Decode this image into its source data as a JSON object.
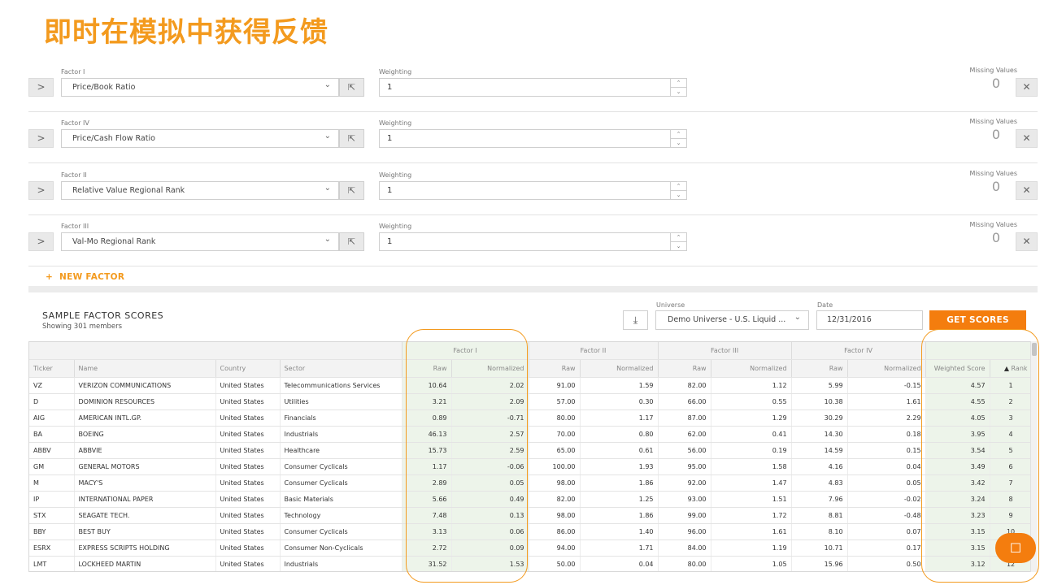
{
  "slide_title": "即时在模拟中获得反馈",
  "factors": [
    {
      "label": "Factor I",
      "value": "Price/Book Ratio",
      "weight_label": "Weighting",
      "weight": "1",
      "missing_label": "Missing Values",
      "missing": "0"
    },
    {
      "label": "Factor IV",
      "value": "Price/Cash Flow Ratio",
      "weight_label": "Weighting",
      "weight": "1",
      "missing_label": "Missing Values",
      "missing": "0"
    },
    {
      "label": "Factor II",
      "value": "Relative Value Regional Rank",
      "weight_label": "Weighting",
      "weight": "1",
      "missing_label": "Missing Values",
      "missing": "0"
    },
    {
      "label": "Factor III",
      "value": "Val-Mo Regional Rank",
      "weight_label": "Weighting",
      "weight": "1",
      "missing_label": "Missing Values",
      "missing": "0"
    }
  ],
  "icons": {
    "expand": ">",
    "chevron": "⌄",
    "cursor": "⇱",
    "remove": "✕",
    "up": "⌃",
    "down": "⌄",
    "download": "⤓",
    "plus": "+",
    "sort": "▲",
    "chat": "☐"
  },
  "new_factor_label": "NEW FACTOR",
  "scores": {
    "title": "SAMPLE FACTOR SCORES",
    "subtitle": "Showing 301 members",
    "universe_label": "Universe",
    "universe_value": "Demo Universe - U.S. Liquid ...",
    "date_label": "Date",
    "date_value": "12/31/2016",
    "get_scores_label": "GET SCORES"
  },
  "table": {
    "groups": [
      "Factor I",
      "Factor II",
      "Factor III",
      "Factor IV"
    ],
    "columns": [
      "Ticker",
      "Name",
      "Country",
      "Sector",
      "Raw",
      "Normalized",
      "Raw",
      "Normalized",
      "Raw",
      "Normalized",
      "Raw",
      "Normalized",
      "Weighted Score",
      "Rank"
    ],
    "rows": [
      [
        "VZ",
        "VERIZON COMMUNICATIONS",
        "United States",
        "Telecommunications Services",
        "10.64",
        "2.02",
        "91.00",
        "1.59",
        "82.00",
        "1.12",
        "5.99",
        "-0.15",
        "4.57",
        "1"
      ],
      [
        "D",
        "DOMINION RESOURCES",
        "United States",
        "Utilities",
        "3.21",
        "2.09",
        "57.00",
        "0.30",
        "66.00",
        "0.55",
        "10.38",
        "1.61",
        "4.55",
        "2"
      ],
      [
        "AIG",
        "AMERICAN INTL.GP.",
        "United States",
        "Financials",
        "0.89",
        "-0.71",
        "80.00",
        "1.17",
        "87.00",
        "1.29",
        "30.29",
        "2.29",
        "4.05",
        "3"
      ],
      [
        "BA",
        "BOEING",
        "United States",
        "Industrials",
        "46.13",
        "2.57",
        "70.00",
        "0.80",
        "62.00",
        "0.41",
        "14.30",
        "0.18",
        "3.95",
        "4"
      ],
      [
        "ABBV",
        "ABBVIE",
        "United States",
        "Healthcare",
        "15.73",
        "2.59",
        "65.00",
        "0.61",
        "56.00",
        "0.19",
        "14.59",
        "0.15",
        "3.54",
        "5"
      ],
      [
        "GM",
        "GENERAL MOTORS",
        "United States",
        "Consumer Cyclicals",
        "1.17",
        "-0.06",
        "100.00",
        "1.93",
        "95.00",
        "1.58",
        "4.16",
        "0.04",
        "3.49",
        "6"
      ],
      [
        "M",
        "MACY'S",
        "United States",
        "Consumer Cyclicals",
        "2.89",
        "0.05",
        "98.00",
        "1.86",
        "92.00",
        "1.47",
        "4.83",
        "0.05",
        "3.42",
        "7"
      ],
      [
        "IP",
        "INTERNATIONAL PAPER",
        "United States",
        "Basic Materials",
        "5.66",
        "0.49",
        "82.00",
        "1.25",
        "93.00",
        "1.51",
        "7.96",
        "-0.02",
        "3.24",
        "8"
      ],
      [
        "STX",
        "SEAGATE TECH.",
        "United States",
        "Technology",
        "7.48",
        "0.13",
        "98.00",
        "1.86",
        "99.00",
        "1.72",
        "8.81",
        "-0.48",
        "3.23",
        "9"
      ],
      [
        "BBY",
        "BEST BUY",
        "United States",
        "Consumer Cyclicals",
        "3.13",
        "0.06",
        "86.00",
        "1.40",
        "96.00",
        "1.61",
        "8.10",
        "0.07",
        "3.15",
        "10"
      ],
      [
        "ESRX",
        "EXPRESS SCRIPTS HOLDING",
        "United States",
        "Consumer Non-Cyclicals",
        "2.72",
        "0.09",
        "94.00",
        "1.71",
        "84.00",
        "1.19",
        "10.71",
        "0.17",
        "3.15",
        "11"
      ],
      [
        "LMT",
        "LOCKHEED MARTIN",
        "United States",
        "Industrials",
        "31.52",
        "1.53",
        "50.00",
        "0.04",
        "80.00",
        "1.05",
        "15.96",
        "0.50",
        "3.12",
        "12"
      ]
    ]
  }
}
